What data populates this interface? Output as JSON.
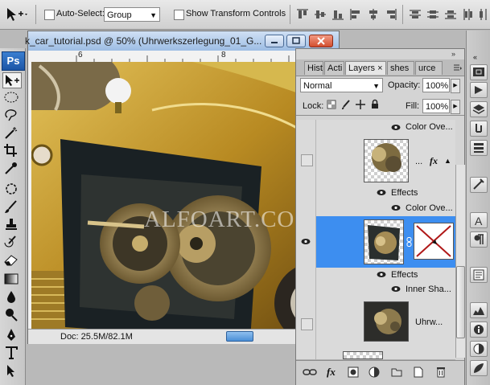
{
  "options_bar": {
    "auto_select_label": "Auto-Select:",
    "auto_select_value": "Group",
    "show_transform_label": "Show Transform Controls"
  },
  "tools": {
    "logo": "Ps",
    "items": [
      "move-tool",
      "marquee-tool",
      "lasso-tool",
      "magic-wand-tool",
      "crop-tool",
      "eyedropper-tool",
      "healing-tool",
      "brush-tool",
      "clone-stamp-tool",
      "history-brush-tool",
      "eraser-tool",
      "gradient-tool",
      "blur-tool",
      "dodge-tool",
      "pen-tool",
      "type-tool",
      "path-select-tool"
    ]
  },
  "document": {
    "title": "k_car_tutorial.psd @ 50% (Uhrwerkszerlegung_01_G...",
    "ruler_marks": [
      "6",
      "8"
    ],
    "status": "Doc: 25.5M/82.1M",
    "watermark": "ALFOART.COM"
  },
  "layers_panel": {
    "tabs": [
      "Hist",
      "Acti",
      "Layers",
      "shes",
      "urce"
    ],
    "active_tab": "Layers",
    "blend_mode": "Normal",
    "opacity_label": "Opacity:",
    "opacity_value": "100%",
    "lock_label": "Lock:",
    "fill_label": "Fill:",
    "fill_value": "100%",
    "rows": {
      "color_overlay_1": "Color Ove...",
      "layer_a_suffix": "...",
      "fx": "fx",
      "effects_1": "Effects",
      "color_overlay_2": "Color Ove...",
      "effects_2": "Effects",
      "inner_shadow": "Inner Sha...",
      "layer_c_name": "Uhrw..."
    }
  },
  "colors": {
    "selection": "#3d8ef0",
    "close_button": "#d24e2e",
    "car_gold": "#b9902a"
  }
}
